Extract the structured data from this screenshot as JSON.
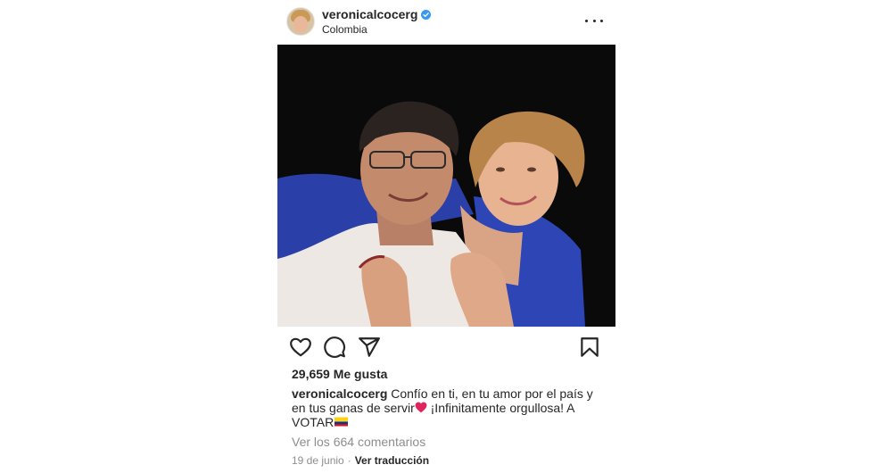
{
  "header": {
    "username": "veronicalcocerg",
    "location": "Colombia",
    "verified": true
  },
  "post": {
    "photo_description_icon": "photo-image",
    "likes": "29,659 Me gusta",
    "caption": {
      "username": "veronicalcocerg",
      "text": " Confío en ti, en tu amor por el país y en tus ganas de servir",
      "text_after_heart": " ¡Infinitamente orgullosa! A VOTAR"
    },
    "view_comments": "Ver los 664 comentarios",
    "date": "19 de junio",
    "separator": "·",
    "translate": "Ver traducción"
  },
  "icons": {
    "like": "heart-outline-icon",
    "comment": "comment-bubble-icon",
    "share": "paper-plane-icon",
    "save": "bookmark-icon",
    "more": "more-dots-icon"
  },
  "colors": {
    "text": "#262626",
    "muted": "#8e8e8e",
    "verified": "#3897f0",
    "heart_emoji": "#e0245e"
  }
}
